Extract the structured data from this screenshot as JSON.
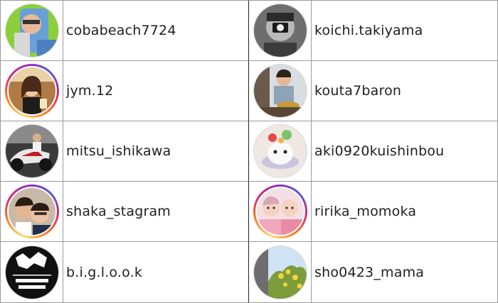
{
  "rows": [
    {
      "left": {
        "username": "cobabeach7724",
        "avatar": "avatar-photo-green-phone-selfie",
        "story": false
      },
      "right": {
        "username": "koichi.takiyama",
        "avatar": "avatar-photo-bw-man-camera",
        "story": false
      }
    },
    {
      "left": {
        "username": "jym.12",
        "avatar": "avatar-photo-woman-cafe",
        "story": true
      },
      "right": {
        "username": "kouta7baron",
        "avatar": "avatar-photo-man-dining",
        "story": false
      }
    },
    {
      "left": {
        "username": "mitsu_ishikawa",
        "avatar": "avatar-photo-motorcycle",
        "story": false
      },
      "right": {
        "username": "aki0920kuishinbou",
        "avatar": "avatar-photo-moomin-dessert",
        "story": false
      }
    },
    {
      "left": {
        "username": "shaka_stagram",
        "avatar": "avatar-photo-two-men-selfie",
        "story": true
      },
      "right": {
        "username": "ririka_momoka",
        "avatar": "avatar-photo-twin-babies",
        "story": true
      }
    },
    {
      "left": {
        "username": "b.i.g.l.o.o.k",
        "avatar": "avatar-logo-no-ramen-no-life",
        "story": false,
        "logo_text": "NO RAMEN, NO LIFE."
      },
      "right": {
        "username": "sho0423_mama",
        "avatar": "avatar-photo-yellow-flowers-sky",
        "story": false
      }
    }
  ]
}
